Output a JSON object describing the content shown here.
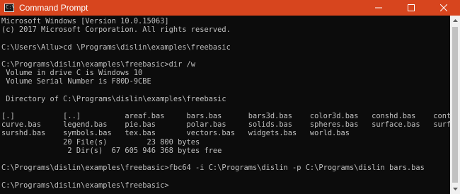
{
  "window": {
    "title": "Command Prompt",
    "icon": "console-icon",
    "icon_glyph": "C:\\"
  },
  "controls": {
    "minimize_icon": "minimize-icon",
    "maximize_icon": "maximize-icon",
    "close_icon": "close-icon"
  },
  "console": {
    "lines": [
      "Microsoft Windows [Version 10.0.15063]",
      "(c) 2017 Microsoft Corporation. All rights reserved.",
      "",
      "C:\\Users\\Allu>cd \\Programs\\dislin\\examples\\freebasic",
      "",
      "C:\\Programs\\dislin\\examples\\freebasic>dir /w",
      " Volume in drive C is Windows 10",
      " Volume Serial Number is F80D-9CBE",
      "",
      " Directory of C:\\Programs\\dislin\\examples\\freebasic",
      "",
      "[.]           [..]          areaf.bas     bars.bas      bars3d.bas    color3d.bas   conshd.bas    contour.bas",
      "curve.bas     legend.bas    pie.bas       polar.bas     solids.bas    spheres.bas   surface.bas   surfcp.bas",
      "surshd.bas    symbols.bas   tex.bas       vectors.bas   widgets.bas   world.bas",
      "              20 File(s)         23 800 bytes",
      "               2 Dir(s)  67 605 946 368 bytes free",
      "",
      "C:\\Programs\\dislin\\examples\\freebasic>fbc64 -i C:\\Programs\\dislin -p C:\\Programs\\dislin bars.bas",
      "",
      "C:\\Programs\\dislin\\examples\\freebasic>"
    ]
  },
  "colors": {
    "titlebar": "#d7451e",
    "console_background": "#0c0c0c",
    "console_text": "#c0c0c0"
  }
}
